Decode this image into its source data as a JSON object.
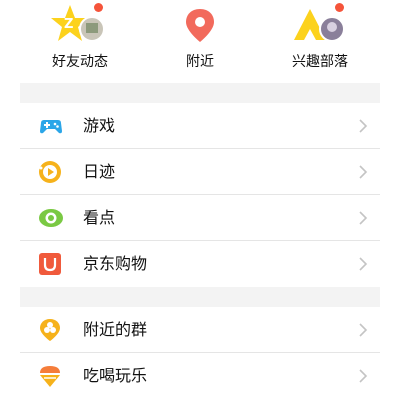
{
  "top_nav": {
    "friends_feed": {
      "label": "好友动态",
      "has_notification": true
    },
    "nearby": {
      "label": "附近"
    },
    "interest_tribe": {
      "label": "兴趣部落",
      "has_notification": true
    }
  },
  "menu_group_1": [
    {
      "label": "游戏",
      "icon": "gamepad-icon",
      "color": "#2ba6e8"
    },
    {
      "label": "日迹",
      "icon": "daily-trace-icon",
      "color": "#f6b21b"
    },
    {
      "label": "看点",
      "icon": "eye-icon",
      "color": "#7ac943"
    },
    {
      "label": "京东购物",
      "icon": "jd-shopping-icon",
      "color": "#f05a3c"
    }
  ],
  "menu_group_2": [
    {
      "label": "附近的群",
      "icon": "nearby-group-icon",
      "color": "#f6b21b"
    },
    {
      "label": "吃喝玩乐",
      "icon": "food-fun-icon",
      "color": "#f57d3a"
    }
  ],
  "colors": {
    "notification": "#f5543a",
    "background_gap": "#f3f3f3",
    "divider": "#e5e5e5",
    "chevron": "#c4c4c4"
  }
}
